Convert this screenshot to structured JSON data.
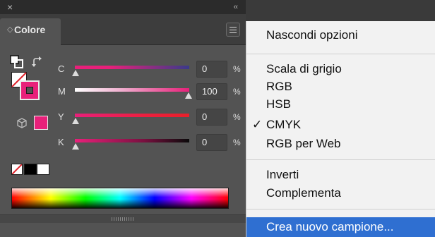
{
  "panel": {
    "close_glyph": "×",
    "collapse_glyph": "‹‹",
    "tab": {
      "arrows": "◇",
      "label": "Colore"
    },
    "sliders": [
      {
        "label": "C",
        "value": "0",
        "unit": "%",
        "position": 0
      },
      {
        "label": "M",
        "value": "100",
        "unit": "%",
        "position": 1
      },
      {
        "label": "Y",
        "value": "0",
        "unit": "%",
        "position": 0
      },
      {
        "label": "K",
        "value": "0",
        "unit": "%",
        "position": 0
      }
    ],
    "colors": {
      "magenta": "#e8207a",
      "panel_bg": "#535353",
      "highlight": "#2f6fd1"
    }
  },
  "menu": {
    "items": [
      {
        "label": "Nascondi opzioni"
      },
      {
        "label": "Scala di grigio"
      },
      {
        "label": "RGB"
      },
      {
        "label": "HSB"
      },
      {
        "label": "CMYK",
        "checked": "✓"
      },
      {
        "label": "RGB per Web"
      },
      {
        "label": "Inverti"
      },
      {
        "label": "Complementa"
      },
      {
        "label": "Crea nuovo campione..."
      }
    ]
  }
}
